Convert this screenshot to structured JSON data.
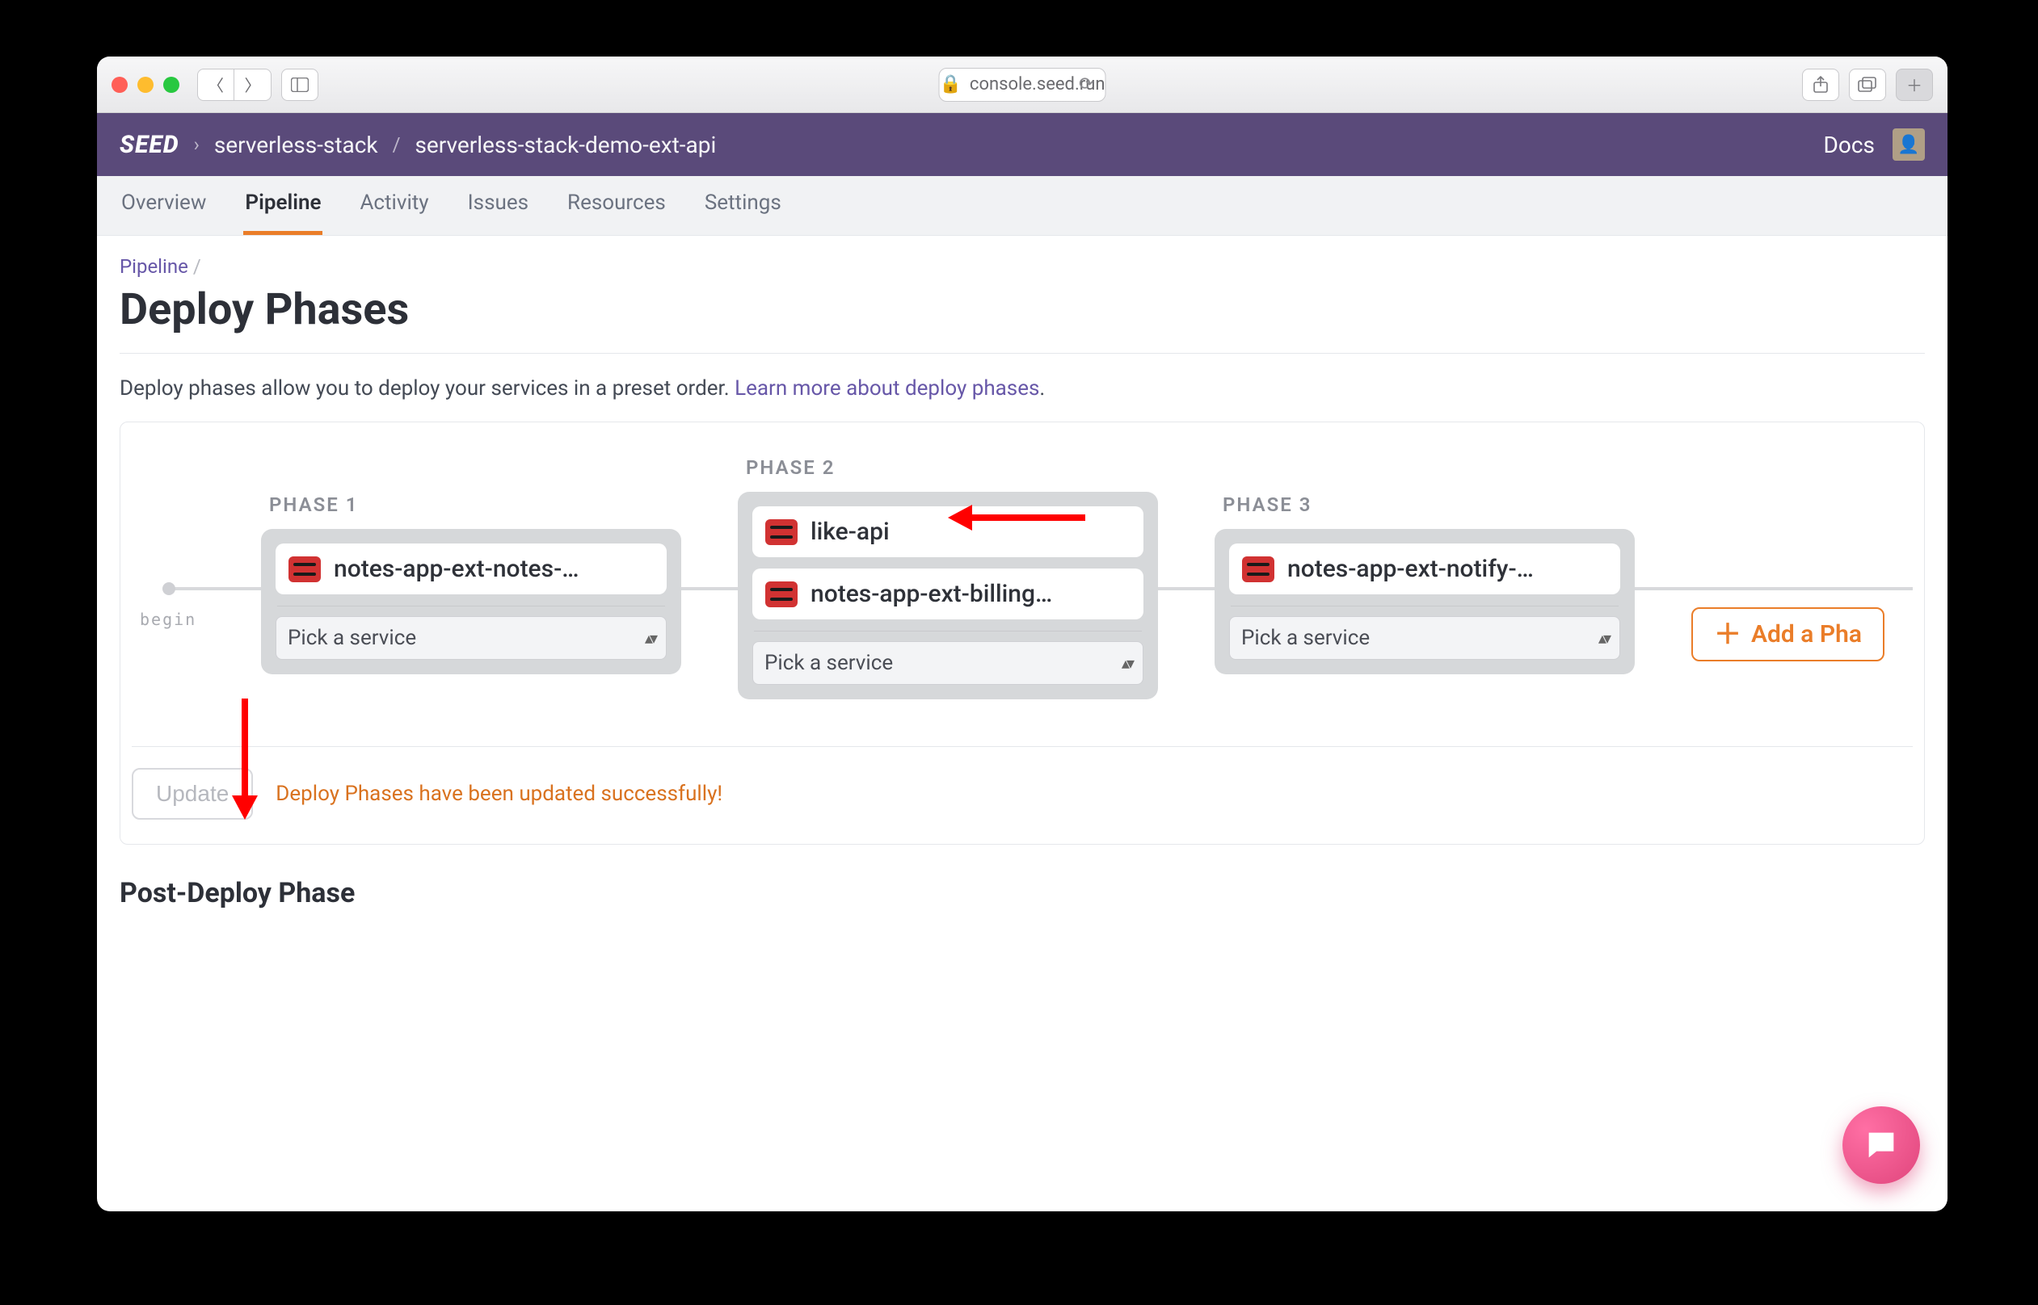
{
  "browser": {
    "url_host": "console.seed.run"
  },
  "header": {
    "logo": "SEED",
    "crumbs": [
      "serverless-stack",
      "serverless-stack-demo-ext-api"
    ],
    "docs": "Docs"
  },
  "tabs": {
    "items": [
      "Overview",
      "Pipeline",
      "Activity",
      "Issues",
      "Resources",
      "Settings"
    ],
    "activeIndex": 1
  },
  "breadcrumb": {
    "root": "Pipeline"
  },
  "page": {
    "title": "Deploy Phases",
    "intro_text": "Deploy phases allow you to deploy your services in a preset order. ",
    "intro_link": "Learn more about deploy phases",
    "intro_period": "."
  },
  "timeline": {
    "begin": "begin"
  },
  "phases": [
    {
      "label": "PHASE 1",
      "services": [
        "notes-app-ext-notes-…"
      ],
      "picker": "Pick a service"
    },
    {
      "label": "PHASE 2",
      "services": [
        "like-api",
        "notes-app-ext-billing…"
      ],
      "picker": "Pick a service"
    },
    {
      "label": "PHASE 3",
      "services": [
        "notes-app-ext-notify-…"
      ],
      "picker": "Pick a service"
    }
  ],
  "add_phase": "Add a Pha",
  "footer": {
    "update": "Update",
    "success": "Deploy Phases have been updated successfully!"
  },
  "post_section": "Post-Deploy Phase"
}
